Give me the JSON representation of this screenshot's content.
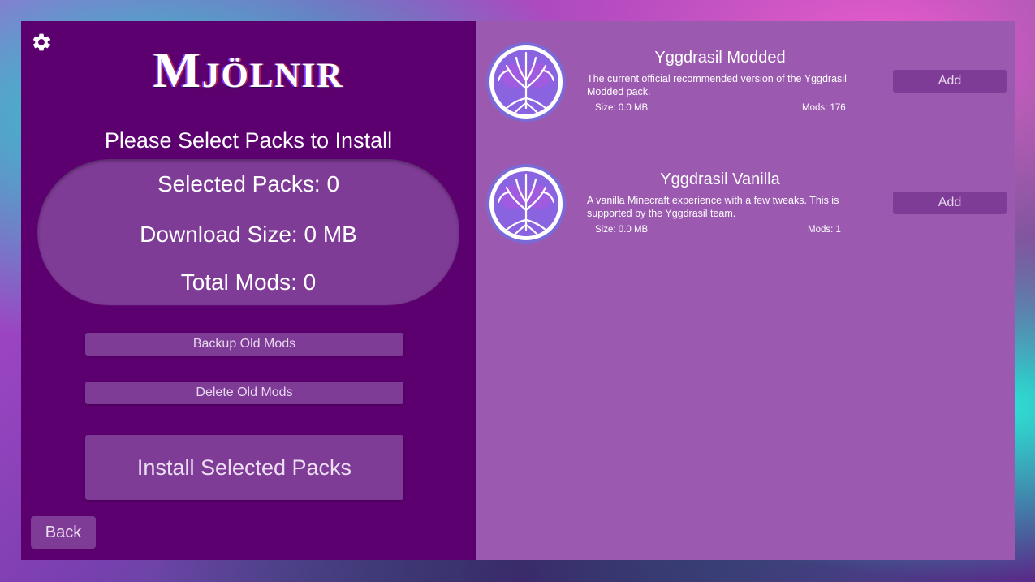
{
  "app": {
    "logo_text": "Mjölnir",
    "settings_icon": "gear-icon"
  },
  "left": {
    "subtitle": "Please Select Packs to Install",
    "summary": {
      "selected_packs": "Selected Packs: 0",
      "download_size": "Download Size: 0 MB",
      "total_mods": "Total Mods: 0"
    },
    "backup_label": "Backup Old Mods",
    "delete_label": "Delete Old Mods",
    "install_label": "Install Selected Packs",
    "back_label": "Back"
  },
  "packs": [
    {
      "icon": "tree-of-life-icon",
      "title": "Yggdrasil Modded",
      "description": "The current official recommended version of the Yggdrasil Modded pack.",
      "size": "Size: 0.0 MB",
      "mods": "Mods: 176",
      "add_label": "Add"
    },
    {
      "icon": "tree-of-life-icon",
      "title": "Yggdrasil Vanilla",
      "description": "A vanilla Minecraft experience with a few tweaks. This is supported by the Yggdrasil team.",
      "size": "Size: 0.0 MB",
      "mods": "Mods: 1",
      "add_label": "Add"
    }
  ],
  "colors": {
    "left_panel": "#5c0070",
    "right_panel": "#9b59b0",
    "button": "#7f3c97"
  }
}
